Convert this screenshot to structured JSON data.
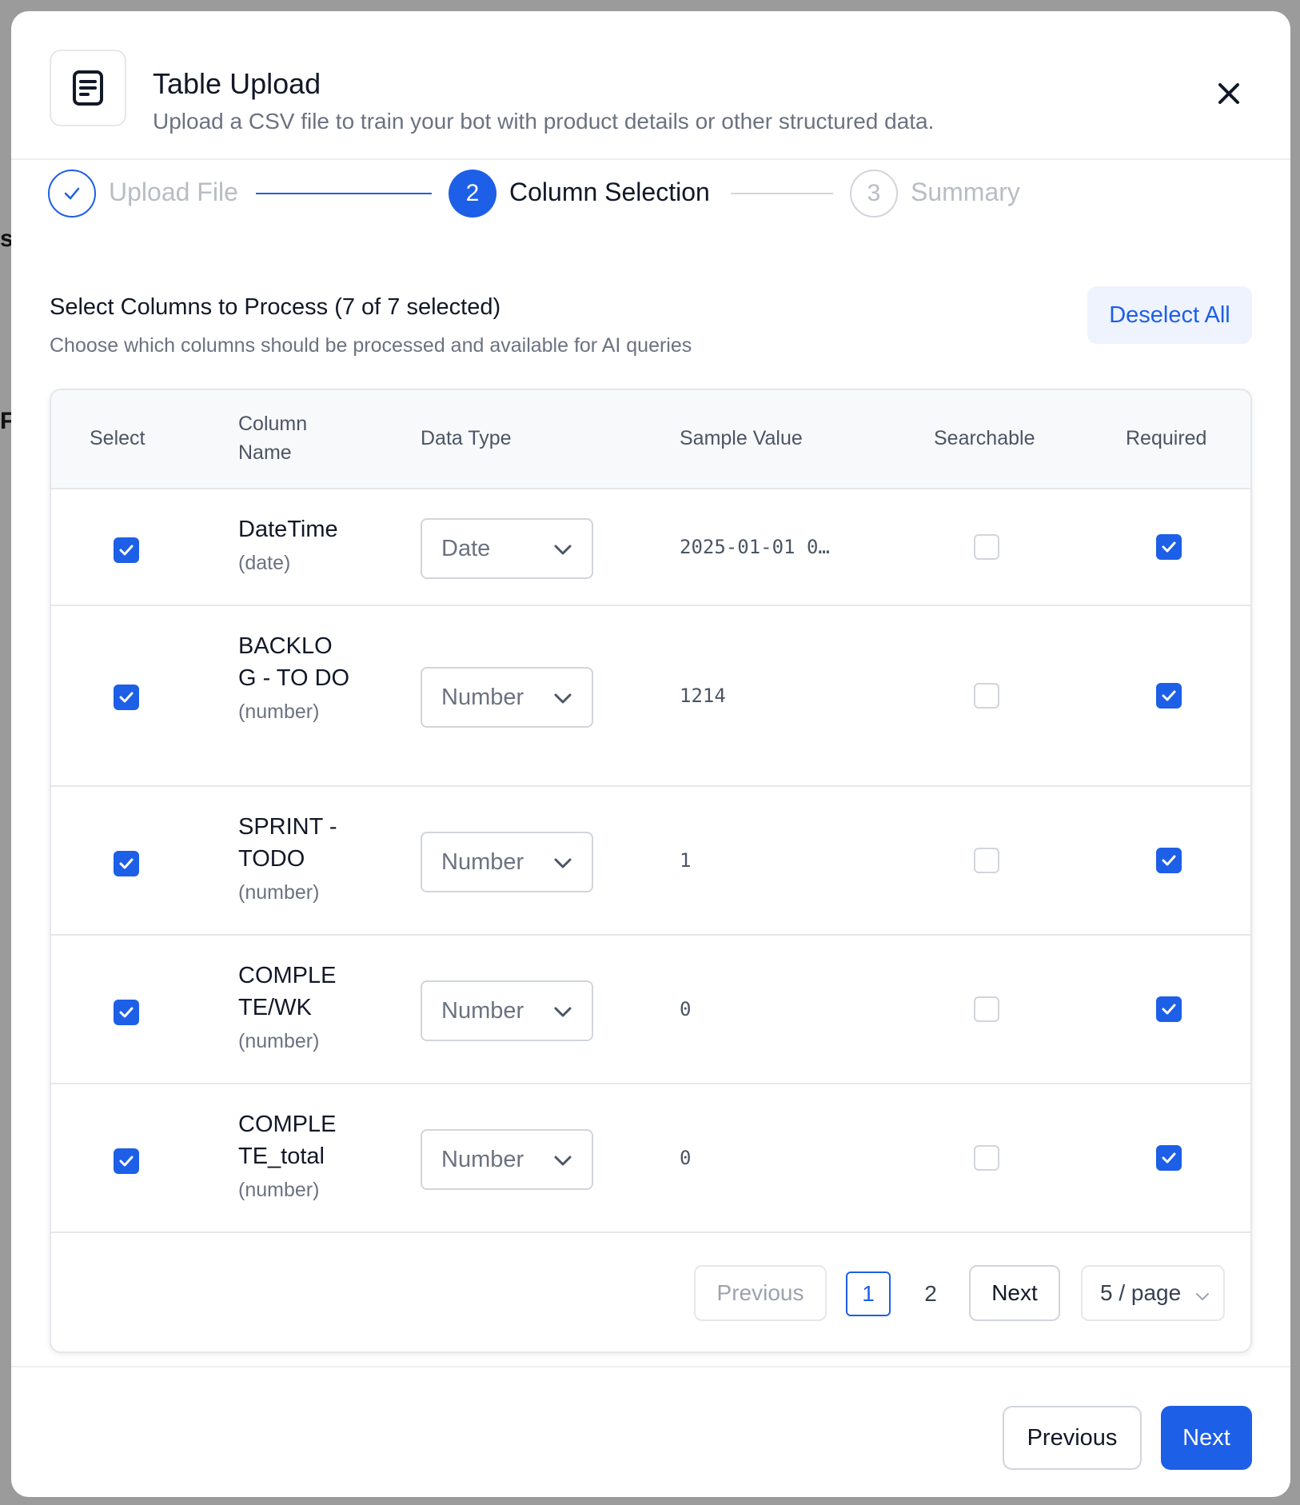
{
  "background": {
    "fragments": [
      "s",
      "F"
    ]
  },
  "header": {
    "title": "Table Upload",
    "subtitle": "Upload a CSV file to train your bot with product details or other structured data.",
    "icon": "file-text-icon"
  },
  "steps": [
    {
      "number": "",
      "label": "Upload File",
      "status": "done"
    },
    {
      "number": "2",
      "label": "Column Selection",
      "status": "active"
    },
    {
      "number": "3",
      "label": "Summary",
      "status": "pending"
    }
  ],
  "section": {
    "title": "Select Columns to Process (7 of 7 selected)",
    "subtitle": "Choose which columns should be processed and available for AI queries",
    "deselect_label": "Deselect All"
  },
  "table": {
    "headers": {
      "select": "Select",
      "column_name_1": "Column",
      "column_name_2": "Name",
      "data_type": "Data Type",
      "sample_value": "Sample Value",
      "searchable": "Searchable",
      "required": "Required"
    },
    "rows": [
      {
        "name": "DateTime",
        "type_hint": "(date)",
        "data_type": "Date",
        "sample": "2025-01-01 0…",
        "selected": true,
        "searchable": false,
        "required": true
      },
      {
        "name": "BACKLOG - TO DO",
        "type_hint": "(number)",
        "data_type": "Number",
        "sample": "1214",
        "selected": true,
        "searchable": false,
        "required": true
      },
      {
        "name": "SPRINT - TODO",
        "type_hint": "(number)",
        "data_type": "Number",
        "sample": "1",
        "selected": true,
        "searchable": false,
        "required": true
      },
      {
        "name": "COMPLETE/WK",
        "type_hint": "(number)",
        "data_type": "Number",
        "sample": "0",
        "selected": true,
        "searchable": false,
        "required": true
      },
      {
        "name": "COMPLETE_total",
        "type_hint": "(number)",
        "data_type": "Number",
        "sample": "0",
        "selected": true,
        "searchable": false,
        "required": true
      }
    ]
  },
  "pagination": {
    "previous_label": "Previous",
    "pages": [
      "1",
      "2"
    ],
    "current_page": "1",
    "next_label": "Next",
    "page_size_label": "5 / page"
  },
  "footer": {
    "previous_label": "Previous",
    "next_label": "Next"
  },
  "colors": {
    "primary": "#1d5fe6",
    "muted_text": "#6b7280",
    "border": "#e5e7eb"
  }
}
